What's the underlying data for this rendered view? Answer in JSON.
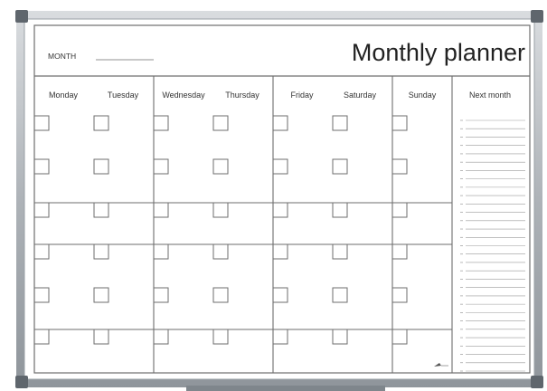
{
  "header": {
    "month_label": "MONTH",
    "title": "Monthly planner"
  },
  "days": [
    "Monday",
    "Tuesday",
    "Wednesday",
    "Thursday",
    "Friday",
    "Saturday",
    "Sunday"
  ],
  "next_month": {
    "label": "Next month",
    "line_count": 31
  },
  "calendar": {
    "week_rows": 6,
    "checkbox_columns": 7
  },
  "colors": {
    "frame": "#b8bcc2",
    "frame_dark": "#8d9298",
    "corner": "#5f666d",
    "line": "#6e6e6e",
    "text": "#333333"
  }
}
